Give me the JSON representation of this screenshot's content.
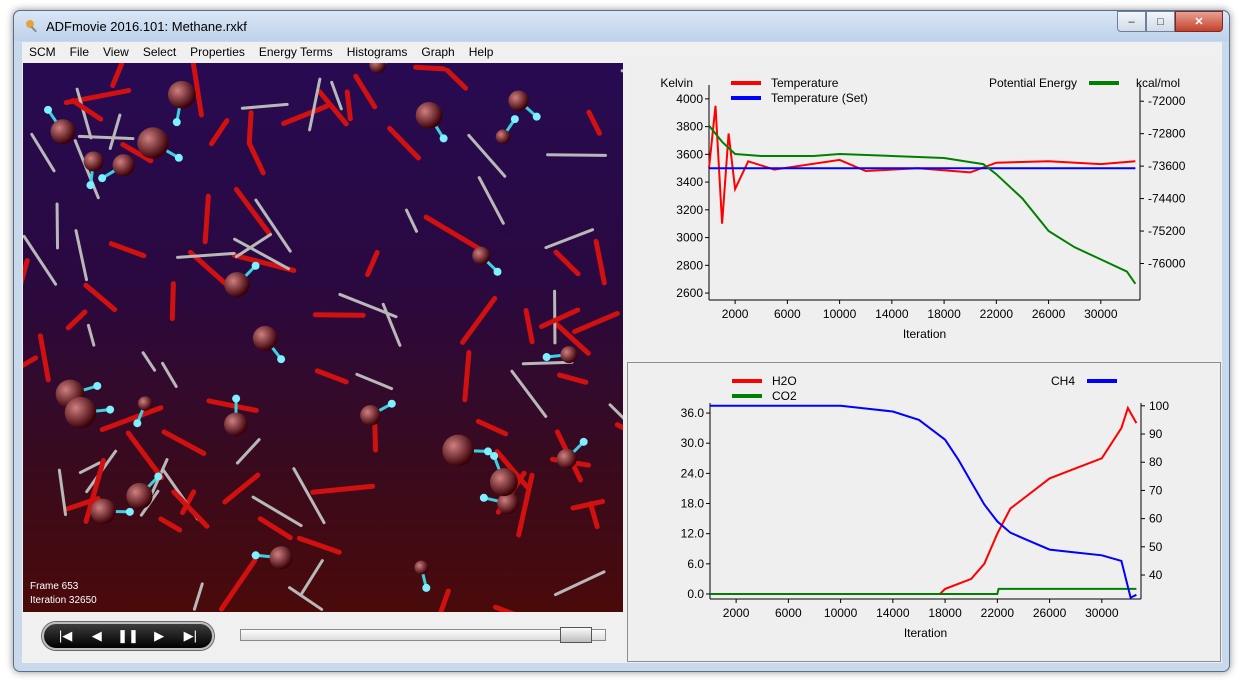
{
  "window": {
    "title": "ADFmovie 2016.101: Methane.rxkf"
  },
  "menu": [
    "SCM",
    "File",
    "View",
    "Select",
    "Properties",
    "Energy Terms",
    "Histograms",
    "Graph",
    "Help"
  ],
  "viewport": {
    "frame_label": "Frame 653",
    "iteration_label": "Iteration 32650"
  },
  "playback": {
    "controls": [
      "first-frame",
      "previous-frame",
      "pause",
      "next-frame",
      "last-frame"
    ],
    "position": 0.96
  },
  "colors": {
    "red": "#ff0000",
    "blue": "#0000ff",
    "green": "#008000"
  },
  "chart_data": [
    {
      "type": "line",
      "xlabel": "Iteration",
      "ylabel": "Kelvin",
      "y2label": "kcal/mol",
      "xticks": [
        2000,
        6000,
        10000,
        14000,
        18000,
        22000,
        26000,
        30000
      ],
      "yticks": [
        2600,
        2800,
        3000,
        3200,
        3400,
        3600,
        3800,
        4000
      ],
      "y2ticks": [
        -72000,
        -72800,
        -73600,
        -74400,
        -75200,
        -76000
      ],
      "xlim": [
        0,
        33000
      ],
      "ylim": [
        2550,
        4100
      ],
      "y2lim": [
        -76900,
        -71600
      ],
      "legend_left": [
        "Temperature",
        "Temperature (Set)"
      ],
      "legend_right": [
        "Potential Energy"
      ],
      "series": [
        {
          "name": "Temperature",
          "axis": "left",
          "color": "#ff0000",
          "x": [
            0,
            500,
            1000,
            1500,
            2000,
            3000,
            5000,
            10000,
            12000,
            16000,
            20000,
            22000,
            26000,
            30000,
            32650
          ],
          "y": [
            3500,
            3950,
            3100,
            3750,
            3350,
            3550,
            3490,
            3560,
            3480,
            3500,
            3470,
            3540,
            3550,
            3530,
            3550
          ]
        },
        {
          "name": "Temperature (Set)",
          "axis": "left",
          "color": "#0000ff",
          "x": [
            0,
            32650
          ],
          "y": [
            3500,
            3500
          ]
        },
        {
          "name": "Potential Energy",
          "axis": "right",
          "color": "#008000",
          "x": [
            0,
            1000,
            2000,
            4000,
            8000,
            10000,
            14000,
            18000,
            20000,
            21000,
            22000,
            24000,
            26000,
            28000,
            30000,
            32000,
            32650
          ],
          "y": [
            -72600,
            -73000,
            -73300,
            -73350,
            -73350,
            -73300,
            -73350,
            -73400,
            -73500,
            -73550,
            -73800,
            -74400,
            -75200,
            -75600,
            -75900,
            -76200,
            -76500
          ]
        }
      ]
    },
    {
      "type": "line",
      "xlabel": "Iteration",
      "xticks": [
        2000,
        6000,
        10000,
        14000,
        18000,
        22000,
        26000,
        30000
      ],
      "yticks": [
        0.0,
        6.0,
        12.0,
        18.0,
        24.0,
        30.0,
        36.0
      ],
      "ytick_labels": [
        "0.0",
        "6.0",
        "12.0",
        "18.0",
        "24.0",
        "30.0",
        "36.0"
      ],
      "y2ticks": [
        40,
        50,
        60,
        70,
        80,
        90,
        100
      ],
      "xlim": [
        0,
        33000
      ],
      "ylim": [
        -1,
        38
      ],
      "y2lim": [
        31.5,
        101
      ],
      "legend_left": [
        "H2O",
        "CO2"
      ],
      "legend_right": [
        "CH4"
      ],
      "series": [
        {
          "name": "H2O",
          "axis": "left",
          "color": "#ff0000",
          "x": [
            17600,
            18000,
            20000,
            21000,
            22000,
            23000,
            24000,
            26000,
            28000,
            30000,
            31500,
            32000,
            32650
          ],
          "y": [
            0,
            1,
            3,
            6,
            12,
            17,
            19,
            23,
            25,
            27,
            33,
            37,
            34
          ]
        },
        {
          "name": "CO2",
          "axis": "left",
          "color": "#008000",
          "x": [
            0,
            22000,
            22100,
            32650
          ],
          "y": [
            0,
            0,
            1,
            1
          ]
        },
        {
          "name": "CH4",
          "axis": "right",
          "color": "#0000ff",
          "x": [
            0,
            10000,
            12000,
            14000,
            16000,
            18000,
            19000,
            20000,
            21000,
            22000,
            23000,
            24000,
            26000,
            28000,
            30000,
            31500,
            32200,
            32650
          ],
          "y": [
            100,
            100,
            99,
            98,
            95,
            88,
            81,
            73,
            65,
            59,
            55,
            53,
            49,
            48,
            47,
            45,
            32,
            33
          ]
        }
      ]
    }
  ]
}
